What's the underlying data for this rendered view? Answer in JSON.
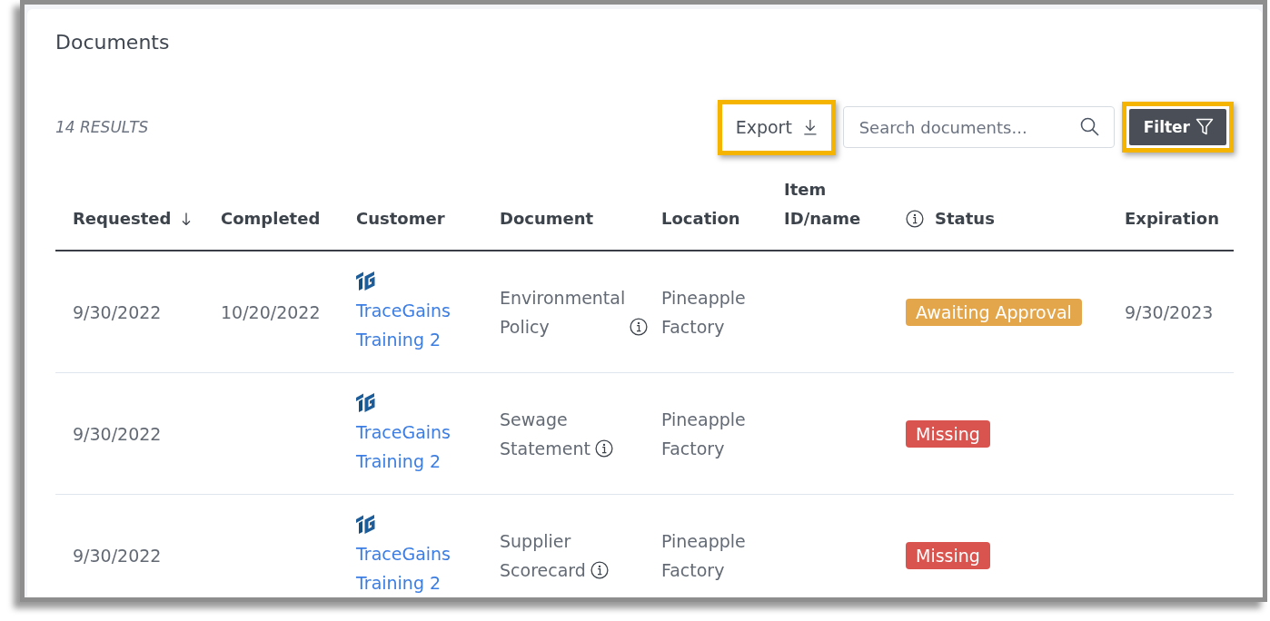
{
  "title": "Documents",
  "toolbar": {
    "result_count": "14 RESULTS",
    "export_button": {
      "label": "Export",
      "highlighted": true
    },
    "search": {
      "placeholder": "Search documents..."
    },
    "filter_button": {
      "label": "Filter",
      "highlighted": true
    }
  },
  "table": {
    "columns": [
      {
        "label": "Requested",
        "sorted": true
      },
      {
        "label": "Completed"
      },
      {
        "label": "Customer"
      },
      {
        "label": "Document"
      },
      {
        "label": "Location"
      },
      {
        "label": "Item ID/name"
      },
      {
        "label": "Status",
        "info": true
      },
      {
        "label": "Expiration"
      }
    ],
    "rows": [
      {
        "requested": "9/30/2022",
        "completed": "10/20/2022",
        "customer": "TraceGains Training 2",
        "document": "Environmental Policy",
        "location": "Pineapple Factory",
        "status": {
          "label": "Awaiting Approval",
          "color": "#e4a64b"
        },
        "expiration": "9/30/2023"
      },
      {
        "requested": "9/30/2022",
        "customer": "TraceGains Training 2",
        "document": "Sewage Statement",
        "location": "Pineapple Factory",
        "status": {
          "label": "Missing",
          "color": "#d9534f"
        }
      },
      {
        "requested": "9/30/2022",
        "customer": "TraceGains Training 2",
        "document": "Supplier Scorecard",
        "location": "Pineapple Factory",
        "status": {
          "label": "Missing",
          "color": "#d9534f"
        }
      }
    ]
  }
}
